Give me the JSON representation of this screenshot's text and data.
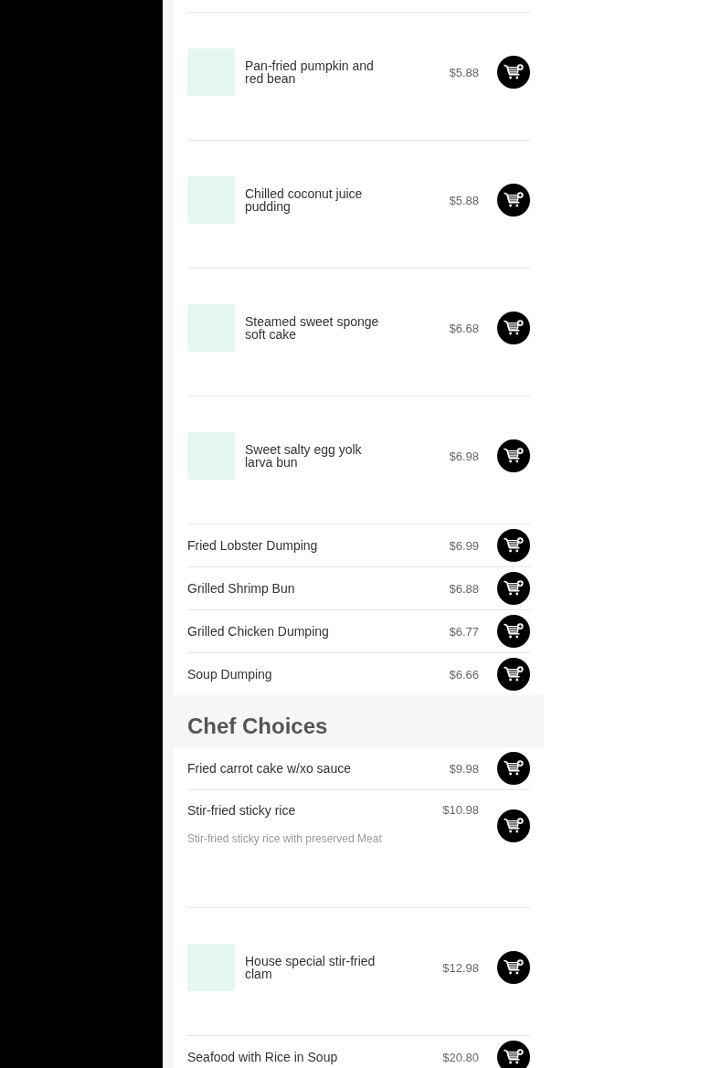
{
  "sections": [
    {
      "items": [
        {
          "kind": "photo",
          "name": "Pan-fried pumpkin and red bean",
          "price": "$5.88"
        },
        {
          "kind": "photo",
          "name": "Chilled coconut juice pudding",
          "price": "$5.88"
        },
        {
          "kind": "photo",
          "name": "Steamed sweet sponge soft cake",
          "price": "$6.68"
        },
        {
          "kind": "photo",
          "name": "Sweet salty egg yolk larva bun",
          "price": "$6.98"
        },
        {
          "kind": "plain",
          "name": "Fried Lobster Dumping",
          "price": "$6.99"
        },
        {
          "kind": "plain",
          "name": "Grilled Shrimp Bun",
          "price": "$6.88"
        },
        {
          "kind": "plain",
          "name": "Grilled Chicken Dumping",
          "price": "$6.77"
        },
        {
          "kind": "plain",
          "name": "Soup Dumping",
          "price": "$6.66"
        }
      ]
    },
    {
      "title": "Chef Choices",
      "items": [
        {
          "kind": "plain",
          "name": "Fried carrot cake w/xo sauce",
          "price": "$9.98"
        },
        {
          "kind": "described",
          "name": "Stir-fried sticky rice",
          "description": "Stir-fried sticky rice with preserved Meat",
          "price": "$10.98"
        },
        {
          "kind": "photo",
          "name": "House special stir-fried clam",
          "price": "$12.98"
        },
        {
          "kind": "plain",
          "name": "Seafood with Rice in Soup",
          "price": "$20.80"
        }
      ]
    }
  ]
}
